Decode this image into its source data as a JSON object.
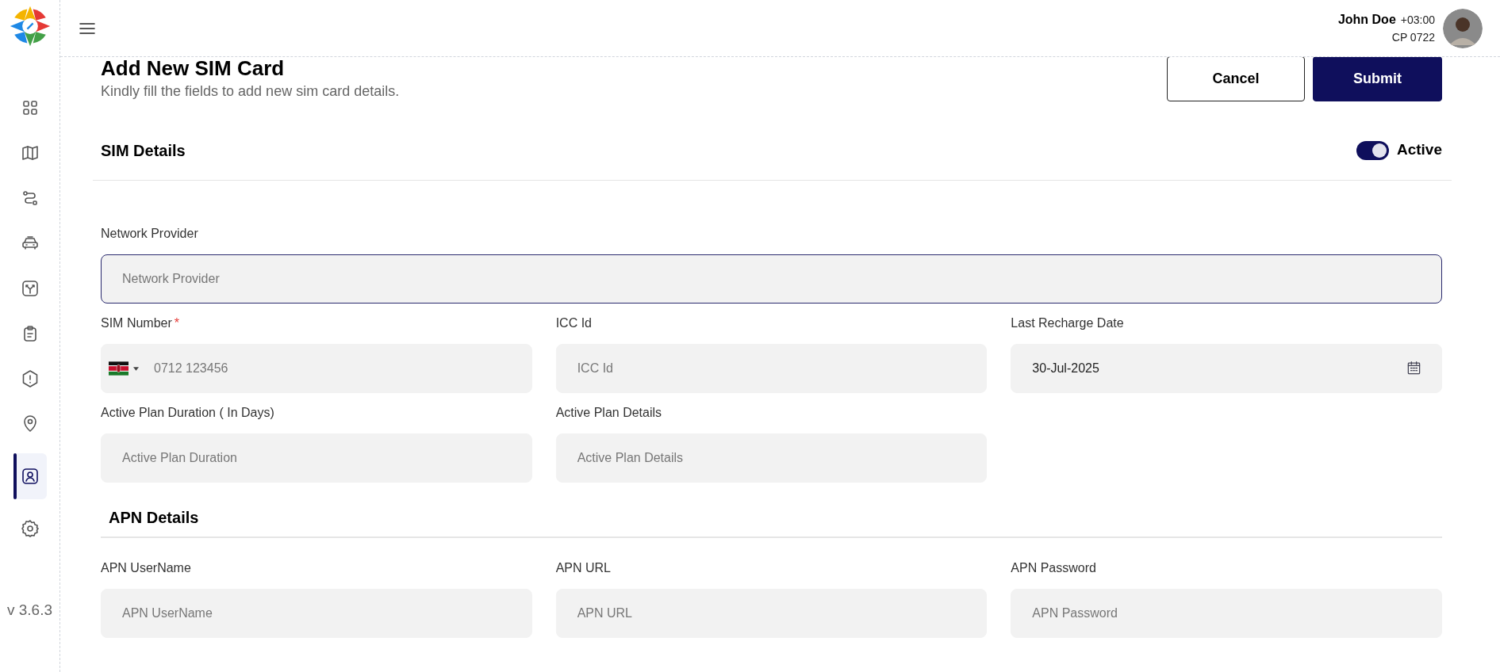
{
  "sidebar": {
    "items": [
      {
        "selected": false
      },
      {
        "selected": false
      },
      {
        "selected": false
      },
      {
        "selected": false
      },
      {
        "selected": false
      },
      {
        "selected": false
      },
      {
        "selected": false
      },
      {
        "selected": false
      },
      {
        "selected": true
      },
      {
        "selected": false
      }
    ],
    "version": "v 3.6.3"
  },
  "header": {
    "user_name": "John Doe",
    "timezone": "+03:00",
    "company": "CP 0722"
  },
  "page": {
    "title": "Add New SIM Card",
    "subtitle": "Kindly fill the fields to add new sim card details.",
    "buttons": [
      {
        "kind": "secondary",
        "label": "Cancel"
      },
      {
        "kind": "primary",
        "label": "Submit"
      }
    ]
  },
  "sections": [
    {
      "title": "SIM Details",
      "toggle": {
        "label": "Active",
        "on": true
      },
      "rows": [
        [
          {
            "kind": "text",
            "label": "Network Provider",
            "placeholder": "Network Provider",
            "focused": true
          }
        ],
        [
          {
            "kind": "phone",
            "label": "SIM Number",
            "required_mark": "*",
            "placeholder": "0712 123456",
            "focused": false
          },
          {
            "kind": "text",
            "label": "ICC Id",
            "placeholder": "ICC Id",
            "focused": false
          },
          {
            "kind": "date",
            "label": "Last Recharge Date",
            "value": "30-Jul-2025",
            "focused": false
          }
        ],
        [
          {
            "kind": "text",
            "label": "Active Plan Duration ( In Days)",
            "placeholder": "Active Plan Duration",
            "focused": false
          },
          {
            "kind": "text",
            "label": "Active Plan Details",
            "placeholder": "Active Plan Details",
            "focused": false
          }
        ]
      ]
    },
    {
      "title": "APN Details",
      "rows": [
        [
          {
            "kind": "text",
            "label": "APN UserName",
            "placeholder": "APN UserName",
            "focused": false
          },
          {
            "kind": "text",
            "label": "APN URL",
            "placeholder": "APN URL",
            "focused": false
          },
          {
            "kind": "text",
            "label": "APN Password",
            "placeholder": "APN Password",
            "focused": false
          }
        ]
      ]
    }
  ]
}
